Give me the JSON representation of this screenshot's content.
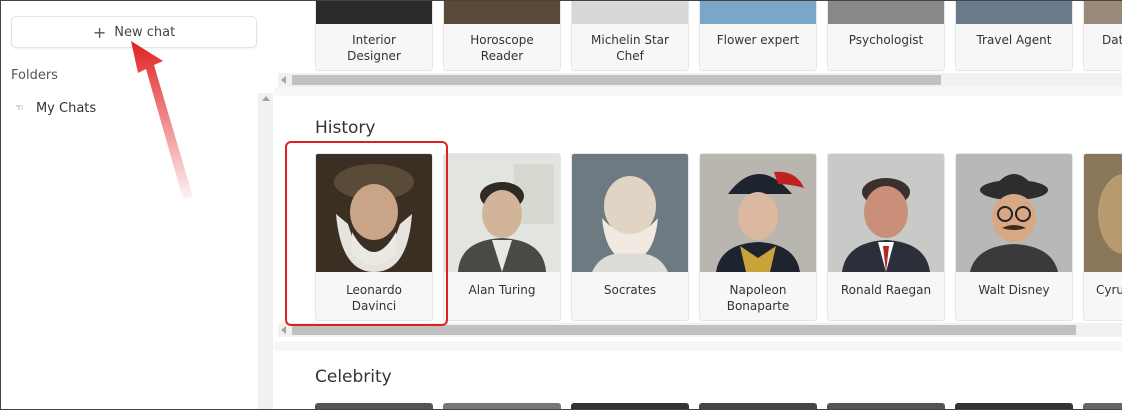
{
  "sidebar": {
    "new_chat_label": "New chat",
    "folders_label": "Folders",
    "folders": [
      {
        "label": "My Chats"
      }
    ]
  },
  "sections": [
    {
      "title": "",
      "cards": [
        {
          "name": "Interior\nDesigner"
        },
        {
          "name": "Horoscope\nReader"
        },
        {
          "name": "Michelin Star\nChef"
        },
        {
          "name": "Flower expert"
        },
        {
          "name": "Psychologist"
        },
        {
          "name": "Travel Agent"
        },
        {
          "name": "Dat"
        }
      ]
    },
    {
      "title": "History",
      "cards": [
        {
          "name": "Leonardo\nDavinci"
        },
        {
          "name": "Alan Turing"
        },
        {
          "name": "Socrates"
        },
        {
          "name": "Napoleon\nBonaparte"
        },
        {
          "name": "Ronald Raegan"
        },
        {
          "name": "Walt Disney"
        },
        {
          "name": "Cyru"
        }
      ]
    },
    {
      "title": "Celebrity",
      "cards": []
    }
  ],
  "colors": {
    "highlight": "#e02020",
    "arrow": "#e02020"
  }
}
